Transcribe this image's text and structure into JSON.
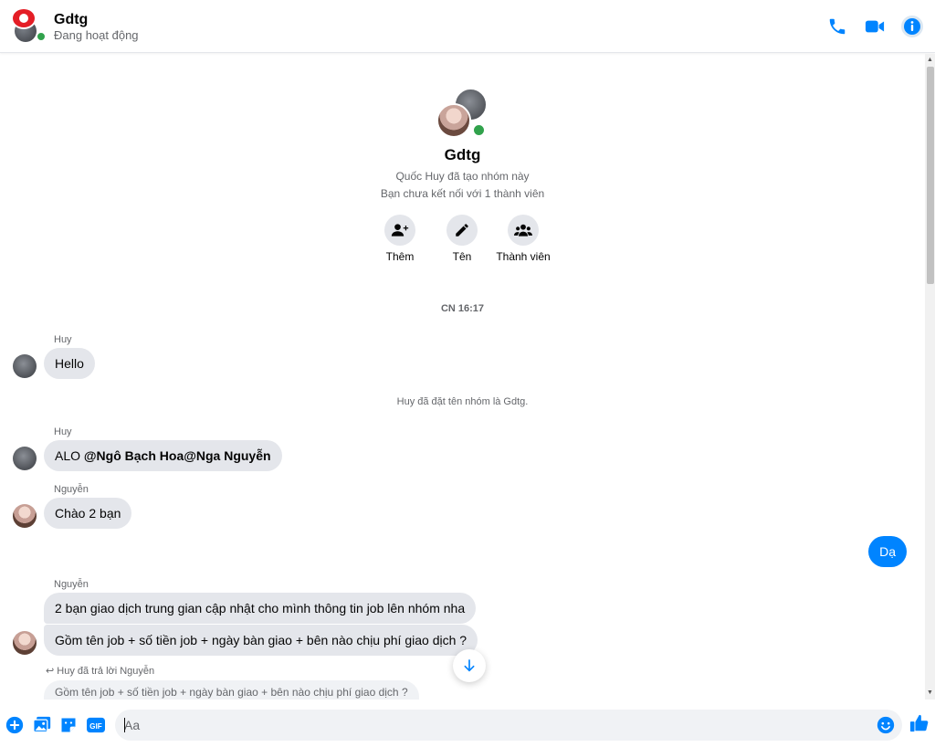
{
  "header": {
    "title": "Gdtg",
    "status": "Đang hoạt động"
  },
  "intro": {
    "group_name": "Gdtg",
    "created_by": "Quốc Huy đã tạo nhóm này",
    "not_connected": "Bạn chưa kết nối với 1 thành viên",
    "actions": [
      {
        "label": "Thêm",
        "icon": "add-person-icon"
      },
      {
        "label": "Tên",
        "icon": "pencil-icon"
      },
      {
        "label": "Thành viên",
        "icon": "members-icon"
      }
    ]
  },
  "conversation": {
    "timestamp": "CN 16:17",
    "system_rename": "Huy đã đặt tên nhóm là Gdtg.",
    "messages": [
      {
        "sender": "Huy",
        "text": "Hello"
      },
      {
        "sender": "Huy",
        "prefix": "ALO ",
        "mentions": "@Ngô Bạch Hoa@Nga Nguyễn"
      },
      {
        "sender": "Nguyễn",
        "text": "Chào 2 bạn"
      },
      {
        "sender": "me",
        "text": "Dạ"
      },
      {
        "sender": "Nguyễn",
        "text": "2 bạn giao dịch trung gian cập nhật cho mình thông tin job lên nhóm nha"
      },
      {
        "sender": "Nguyễn",
        "text": "Gồm tên job + số tiền job + ngày bàn giao + bên nào chịu phí giao dịch ?"
      }
    ],
    "reply_note": "Huy đã trả lời Nguyễn",
    "reply_quote": "Gồm tên job + số tiền job + ngày bàn giao + bên nào chịu phí giao dịch ?"
  },
  "composer": {
    "placeholder": "Aa",
    "value": "",
    "gif_label": "GIF"
  },
  "colors": {
    "accent": "#0084ff",
    "online": "#31a24c",
    "bubble_gray": "#e4e6eb"
  }
}
